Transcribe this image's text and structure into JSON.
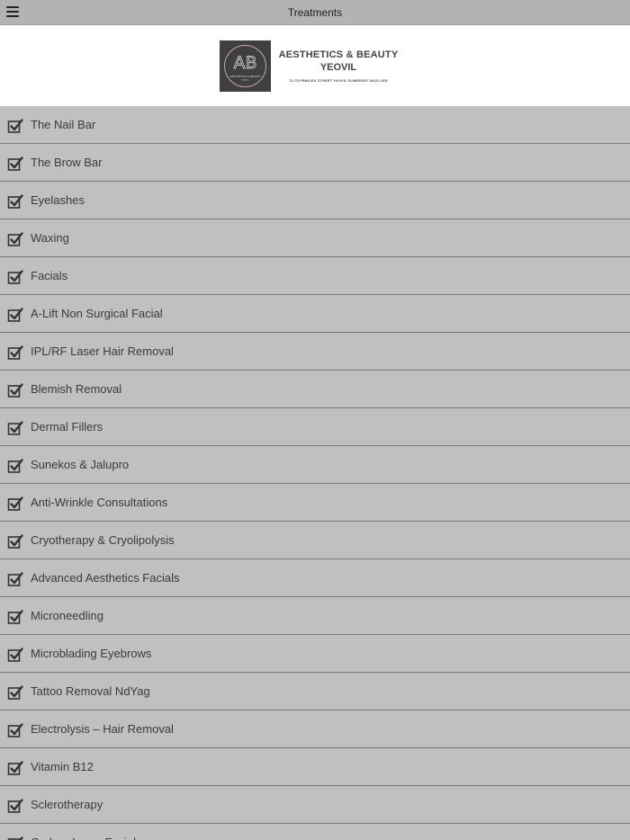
{
  "topbar": {
    "title": "Treatments",
    "menu_icon": "hamburger-menu-icon"
  },
  "header": {
    "logo_monogram": "AB",
    "logo_small_text": "AESTHETICS & BEAUTY",
    "logo_small_sub": "YEOVIL",
    "brand_line1": "AESTHETICS & BEAUTY",
    "brand_line2": "YEOVIL",
    "address": "73-75 PRINCES STREET YEOVIL SOMERSET BA20 1EE"
  },
  "colors": {
    "topbar_bg": "#b3b3b3",
    "row_bg": "#c0c0c0",
    "header_bg": "#ffffff",
    "logo_bg": "#3f3f3f",
    "logo_accent": "#c9a7b2"
  },
  "list_icon": "checkbox-checked-icon",
  "treatments": [
    {
      "label": "The Nail Bar"
    },
    {
      "label": "The Brow Bar"
    },
    {
      "label": "Eyelashes"
    },
    {
      "label": "Waxing"
    },
    {
      "label": "Facials"
    },
    {
      "label": "A-Lift Non Surgical Facial"
    },
    {
      "label": "IPL/RF Laser Hair Removal"
    },
    {
      "label": "Blemish Removal"
    },
    {
      "label": "Dermal Fillers"
    },
    {
      "label": "Sunekos & Jalupro"
    },
    {
      "label": "Anti-Wrinkle Consultations"
    },
    {
      "label": "Cryotherapy & Cryolipolysis"
    },
    {
      "label": "Advanced Aesthetics Facials"
    },
    {
      "label": "Microneedling"
    },
    {
      "label": "Microblading Eyebrows"
    },
    {
      "label": "Tattoo Removal NdYag"
    },
    {
      "label": "Electrolysis – Hair Removal"
    },
    {
      "label": "Vitamin B12"
    },
    {
      "label": "Sclerotherapy"
    },
    {
      "label": "Carbon Laser Facial"
    }
  ]
}
